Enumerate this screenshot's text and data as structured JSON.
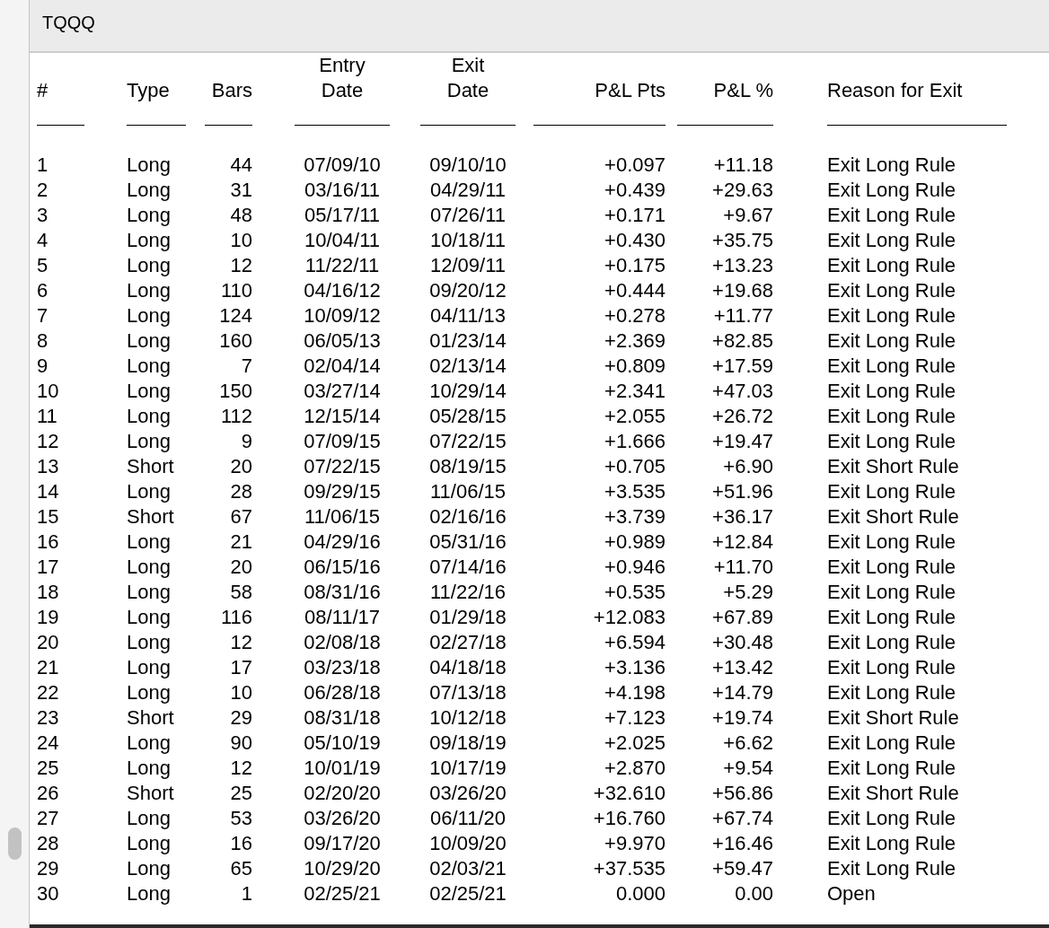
{
  "window": {
    "title": "TQQQ"
  },
  "table": {
    "columns": [
      {
        "lines": [
          "#"
        ]
      },
      {
        "lines": [
          "Type"
        ]
      },
      {
        "lines": [
          "Bars"
        ]
      },
      {
        "lines": [
          "Entry",
          "Date"
        ]
      },
      {
        "lines": [
          "Exit",
          "Date"
        ]
      },
      {
        "lines": [
          "P&L Pts"
        ]
      },
      {
        "lines": [
          "P&L %"
        ]
      },
      {
        "lines": [
          "Reason for Exit"
        ]
      }
    ],
    "rows": [
      [
        "1",
        "Long",
        "44",
        "07/09/10",
        "09/10/10",
        "+0.097",
        "+11.18",
        "Exit Long Rule"
      ],
      [
        "2",
        "Long",
        "31",
        "03/16/11",
        "04/29/11",
        "+0.439",
        "+29.63",
        "Exit Long Rule"
      ],
      [
        "3",
        "Long",
        "48",
        "05/17/11",
        "07/26/11",
        "+0.171",
        "+9.67",
        "Exit Long Rule"
      ],
      [
        "4",
        "Long",
        "10",
        "10/04/11",
        "10/18/11",
        "+0.430",
        "+35.75",
        "Exit Long Rule"
      ],
      [
        "5",
        "Long",
        "12",
        "11/22/11",
        "12/09/11",
        "+0.175",
        "+13.23",
        "Exit Long Rule"
      ],
      [
        "6",
        "Long",
        "110",
        "04/16/12",
        "09/20/12",
        "+0.444",
        "+19.68",
        "Exit Long Rule"
      ],
      [
        "7",
        "Long",
        "124",
        "10/09/12",
        "04/11/13",
        "+0.278",
        "+11.77",
        "Exit Long Rule"
      ],
      [
        "8",
        "Long",
        "160",
        "06/05/13",
        "01/23/14",
        "+2.369",
        "+82.85",
        "Exit Long Rule"
      ],
      [
        "9",
        "Long",
        "7",
        "02/04/14",
        "02/13/14",
        "+0.809",
        "+17.59",
        "Exit Long Rule"
      ],
      [
        "10",
        "Long",
        "150",
        "03/27/14",
        "10/29/14",
        "+2.341",
        "+47.03",
        "Exit Long Rule"
      ],
      [
        "11",
        "Long",
        "112",
        "12/15/14",
        "05/28/15",
        "+2.055",
        "+26.72",
        "Exit Long Rule"
      ],
      [
        "12",
        "Long",
        "9",
        "07/09/15",
        "07/22/15",
        "+1.666",
        "+19.47",
        "Exit Long Rule"
      ],
      [
        "13",
        "Short",
        "20",
        "07/22/15",
        "08/19/15",
        "+0.705",
        "+6.90",
        "Exit Short Rule"
      ],
      [
        "14",
        "Long",
        "28",
        "09/29/15",
        "11/06/15",
        "+3.535",
        "+51.96",
        "Exit Long Rule"
      ],
      [
        "15",
        "Short",
        "67",
        "11/06/15",
        "02/16/16",
        "+3.739",
        "+36.17",
        "Exit Short Rule"
      ],
      [
        "16",
        "Long",
        "21",
        "04/29/16",
        "05/31/16",
        "+0.989",
        "+12.84",
        "Exit Long Rule"
      ],
      [
        "17",
        "Long",
        "20",
        "06/15/16",
        "07/14/16",
        "+0.946",
        "+11.70",
        "Exit Long Rule"
      ],
      [
        "18",
        "Long",
        "58",
        "08/31/16",
        "11/22/16",
        "+0.535",
        "+5.29",
        "Exit Long Rule"
      ],
      [
        "19",
        "Long",
        "116",
        "08/11/17",
        "01/29/18",
        "+12.083",
        "+67.89",
        "Exit Long Rule"
      ],
      [
        "20",
        "Long",
        "12",
        "02/08/18",
        "02/27/18",
        "+6.594",
        "+30.48",
        "Exit Long Rule"
      ],
      [
        "21",
        "Long",
        "17",
        "03/23/18",
        "04/18/18",
        "+3.136",
        "+13.42",
        "Exit Long Rule"
      ],
      [
        "22",
        "Long",
        "10",
        "06/28/18",
        "07/13/18",
        "+4.198",
        "+14.79",
        "Exit Long Rule"
      ],
      [
        "23",
        "Short",
        "29",
        "08/31/18",
        "10/12/18",
        "+7.123",
        "+19.74",
        "Exit Short Rule"
      ],
      [
        "24",
        "Long",
        "90",
        "05/10/19",
        "09/18/19",
        "+2.025",
        "+6.62",
        "Exit Long Rule"
      ],
      [
        "25",
        "Long",
        "12",
        "10/01/19",
        "10/17/19",
        "+2.870",
        "+9.54",
        "Exit Long Rule"
      ],
      [
        "26",
        "Short",
        "25",
        "02/20/20",
        "03/26/20",
        "+32.610",
        "+56.86",
        "Exit Short Rule"
      ],
      [
        "27",
        "Long",
        "53",
        "03/26/20",
        "06/11/20",
        "+16.760",
        "+67.74",
        "Exit Long Rule"
      ],
      [
        "28",
        "Long",
        "16",
        "09/17/20",
        "10/09/20",
        "+9.970",
        "+16.46",
        "Exit Long Rule"
      ],
      [
        "29",
        "Long",
        "65",
        "10/29/20",
        "02/03/21",
        "+37.535",
        "+59.47",
        "Exit Long Rule"
      ],
      [
        "30",
        "Long",
        "1",
        "02/25/21",
        "02/25/21",
        "0.000",
        "0.00",
        "Open"
      ]
    ]
  }
}
